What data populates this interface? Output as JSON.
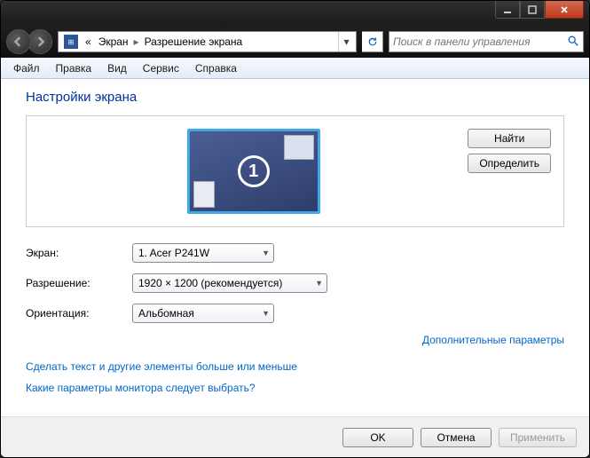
{
  "breadcrumb": {
    "root_prefix": "«",
    "root": "Экран",
    "current": "Разрешение экрана"
  },
  "search": {
    "placeholder": "Поиск в панели управления"
  },
  "menu": {
    "file": "Файл",
    "edit": "Правка",
    "view": "Вид",
    "tools": "Сервис",
    "help": "Справка"
  },
  "page": {
    "title": "Настройки экрана",
    "find": "Найти",
    "detect": "Определить",
    "monitor_number": "1",
    "labels": {
      "screen": "Экран:",
      "resolution": "Разрешение:",
      "orientation": "Ориентация:"
    },
    "values": {
      "screen": "1. Acer P241W",
      "resolution": "1920 × 1200 (рекомендуется)",
      "orientation": "Альбомная"
    },
    "advanced": "Дополнительные параметры",
    "help1": "Сделать текст и другие элементы больше или меньше",
    "help2": "Какие параметры монитора следует выбрать?"
  },
  "footer": {
    "ok": "OK",
    "cancel": "Отмена",
    "apply": "Применить"
  }
}
